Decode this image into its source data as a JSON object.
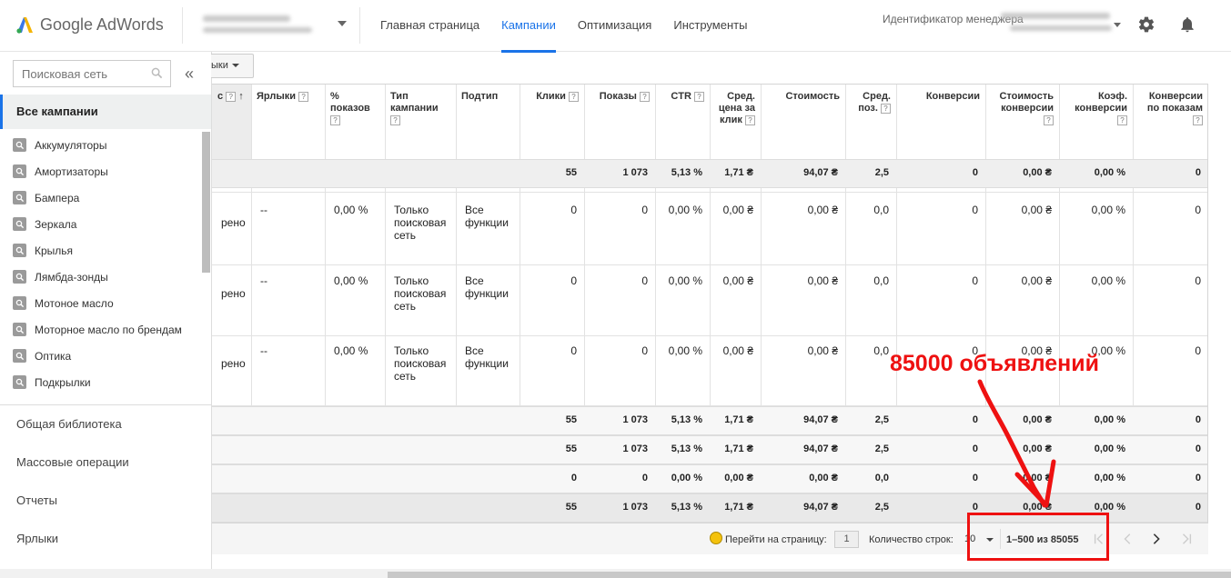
{
  "header": {
    "logo_text": "Google AdWords",
    "nav": [
      "Главная страница",
      "Кампании",
      "Оптимизация",
      "Инструменты"
    ],
    "active_nav": "Кампании",
    "manager_id_label": "Идентификатор менеджера"
  },
  "sidebar": {
    "search_placeholder": "Поисковая сеть",
    "collapse_label": "«",
    "all_campaigns": "Все кампании",
    "campaigns": [
      "Аккумуляторы",
      "Амортизаторы",
      "Бампера",
      "Зеркала",
      "Крылья",
      "Лямбда-зонды",
      "Мотоное масло",
      "Моторное масло по брендам",
      "Оптика",
      "Подкрылки"
    ],
    "sections": [
      "Общая библиотека",
      "Массовые операции",
      "Отчеты",
      "Ярлыки"
    ]
  },
  "toolbar": {
    "segment_label": "ыки"
  },
  "table": {
    "headers": {
      "status": "с",
      "labels": "Ярлыки",
      "pct_impr": "% показов",
      "campaign_type": "Тип кампании",
      "subtype": "Подтип",
      "clicks": "Клики",
      "impressions": "Показы",
      "ctr": "CTR",
      "avg_cpc": "Сред. цена за клик",
      "cost": "Стоимость",
      "avg_pos": "Сред. поз.",
      "conversions": "Конверсии",
      "cost_conv": "Стоимость конверсии",
      "conv_rate": "Коэф. конверсии",
      "view_conv": "Конверсии по показам"
    },
    "summary_top": [
      "55",
      "1 073",
      "5,13 %",
      "1,71 ₴",
      "94,07 ₴",
      "2,5",
      "0",
      "0,00 ₴",
      "0,00 %",
      "0"
    ],
    "rows": [
      {
        "status": "рено",
        "labels": "--",
        "pct_impr": "0,00 %",
        "type": "Только поисковая сеть",
        "subtype": "Все функции",
        "values": [
          "0",
          "0",
          "0,00 %",
          "0,00 ₴",
          "0,00 ₴",
          "0,0",
          "0",
          "0,00 ₴",
          "0,00 %",
          "0"
        ]
      },
      {
        "status": "рено",
        "labels": "--",
        "pct_impr": "0,00 %",
        "type": "Только поисковая сеть",
        "subtype": "Все функции",
        "values": [
          "0",
          "0",
          "0,00 %",
          "0,00 ₴",
          "0,00 ₴",
          "0,0",
          "0",
          "0,00 ₴",
          "0,00 %",
          "0"
        ]
      },
      {
        "status": "рено",
        "labels": "--",
        "pct_impr": "0,00 %",
        "type": "Только поисковая сеть",
        "subtype": "Все функции",
        "values": [
          "0",
          "0",
          "0,00 %",
          "0,00 ₴",
          "0,00 ₴",
          "0,0",
          "0",
          "0,00 ₴",
          "0,00 %",
          "0"
        ]
      }
    ],
    "totals": [
      [
        "55",
        "1 073",
        "5,13 %",
        "1,71 ₴",
        "94,07 ₴",
        "2,5",
        "0",
        "0,00 ₴",
        "0,00 %",
        "0"
      ],
      [
        "55",
        "1 073",
        "5,13 %",
        "1,71 ₴",
        "94,07 ₴",
        "2,5",
        "0",
        "0,00 ₴",
        "0,00 %",
        "0"
      ],
      [
        "0",
        "0",
        "0,00 %",
        "0,00 ₴",
        "0,00 ₴",
        "0,0",
        "0",
        "0,00 ₴",
        "0,00 %",
        "0"
      ],
      [
        "55",
        "1 073",
        "5,13 %",
        "1,71 ₴",
        "94,07 ₴",
        "2,5",
        "0",
        "0,00 ₴",
        "0,00 %",
        "0"
      ]
    ]
  },
  "footer": {
    "goto_label": "Перейти на страницу:",
    "page_value": "1",
    "rows_label": "Количество строк:",
    "rows_value": "10",
    "range_text": "1–500 из 85055"
  },
  "annotation": {
    "text": "85000 объявлений",
    "color": "#ee1111"
  }
}
